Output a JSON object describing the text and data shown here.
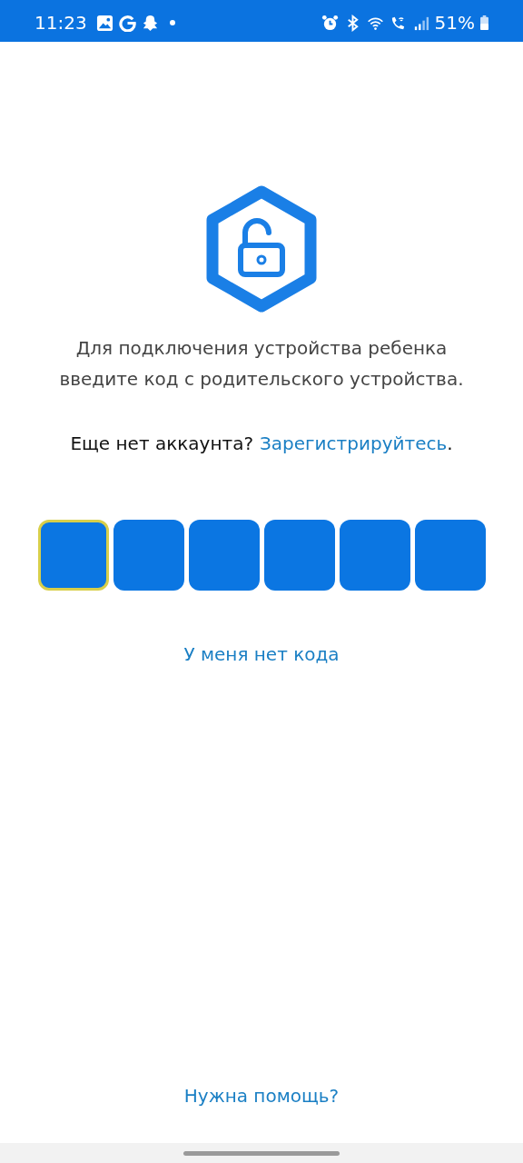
{
  "status_bar": {
    "time": "11:23",
    "battery": "51%"
  },
  "instruction": "Для подключения устройства ребенка введите код с родительского устройства.",
  "signup": {
    "prompt": "Еще нет аккаунта?",
    "link": "Зарегистрируйтесь",
    "suffix": "."
  },
  "code_cells": [
    {
      "selected": true
    },
    {
      "selected": false
    },
    {
      "selected": false
    },
    {
      "selected": false
    },
    {
      "selected": false
    },
    {
      "selected": false
    }
  ],
  "no_code_link": "У меня нет кода",
  "help_link": "Нужна помощь?"
}
